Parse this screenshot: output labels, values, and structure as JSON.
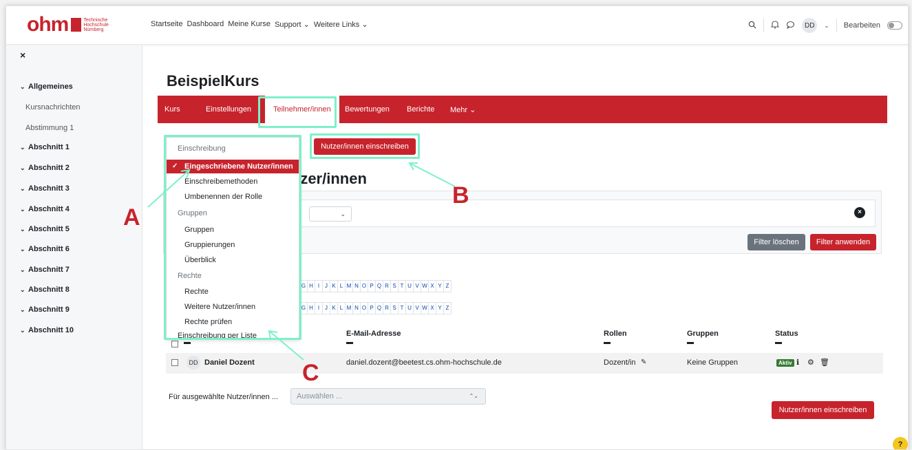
{
  "logo": {
    "text": "ohm",
    "sub1": "Technische",
    "sub2": "Hochschule",
    "sub3": "Nürnberg"
  },
  "topnav": {
    "items": [
      "Startseite",
      "Dashboard",
      "Meine Kurse",
      "Support ⌄",
      "Weitere Links ⌄"
    ]
  },
  "topright": {
    "avatar": "DD",
    "edit_label": "Bearbeiten"
  },
  "icons": {
    "search": "search-icon",
    "bell": "bell-icon",
    "chat": "chat-icon",
    "close": "close-icon"
  },
  "sidebar": {
    "close": "×",
    "items": [
      {
        "label": "Allgemeines",
        "type": "section"
      },
      {
        "label": "Kursnachrichten",
        "type": "sub"
      },
      {
        "label": "Abstimmung 1",
        "type": "sub"
      },
      {
        "label": "Abschnitt 1",
        "type": "section"
      },
      {
        "label": "Abschnitt 2",
        "type": "section"
      },
      {
        "label": "Abschnitt 3",
        "type": "section"
      },
      {
        "label": "Abschnitt 4",
        "type": "section"
      },
      {
        "label": "Abschnitt 5",
        "type": "section"
      },
      {
        "label": "Abschnitt 6",
        "type": "section"
      },
      {
        "label": "Abschnitt 7",
        "type": "section"
      },
      {
        "label": "Abschnitt 8",
        "type": "section"
      },
      {
        "label": "Abschnitt 9",
        "type": "section"
      },
      {
        "label": "Abschnitt 10",
        "type": "section"
      }
    ]
  },
  "course": {
    "title": "BeispielKurs"
  },
  "coursenav": {
    "kurs": "Kurs",
    "einstellungen": "Einstellungen",
    "teilnehmer": "Teilnehmer/innen",
    "bewertungen": "Bewertungen",
    "berichte": "Berichte",
    "mehr": "Mehr ⌄"
  },
  "dropdown": {
    "head1": "Einschreibung",
    "selected": "Eingeschriebene Nutzer/innen",
    "item_methods": "Einschreibemethoden",
    "item_rename": "Umbenennen der Rolle",
    "head2": "Gruppen",
    "item_groups": "Gruppen",
    "item_groupings": "Gruppierungen",
    "item_overview": "Überblick",
    "head3": "Rechte",
    "item_rights": "Rechte",
    "item_other_users": "Weitere Nutzer/innen",
    "item_check_rights": "Rechte prüfen",
    "item_list": "Einschreibung per Liste"
  },
  "buttons": {
    "enrol": "Nutzer/innen einschreiben",
    "filter_clear": "Filter löschen",
    "filter_apply": "Filter anwenden"
  },
  "page": {
    "heading": "tzer/innen"
  },
  "letters": [
    "G",
    "H",
    "I",
    "J",
    "K",
    "L",
    "M",
    "N",
    "O",
    "P",
    "Q",
    "R",
    "S",
    "T",
    "U",
    "V",
    "W",
    "X",
    "Y",
    "Z"
  ],
  "table": {
    "headers": {
      "email": "E-Mail-Adresse",
      "roles": "Rollen",
      "groups": "Gruppen",
      "status": "Status"
    },
    "row": {
      "initials": "DD",
      "name": "Daniel Dozent",
      "email": "daniel.dozent@beetest.cs.ohm-hochschule.de",
      "role": "Dozent/in",
      "groups": "Keine Gruppen",
      "status": "Aktiv"
    }
  },
  "bulk": {
    "label": "Für ausgewählte Nutzer/innen ...",
    "placeholder": "Auswählen ..."
  },
  "annotations": {
    "a": "A",
    "b": "B",
    "c": "C"
  },
  "help": "?"
}
